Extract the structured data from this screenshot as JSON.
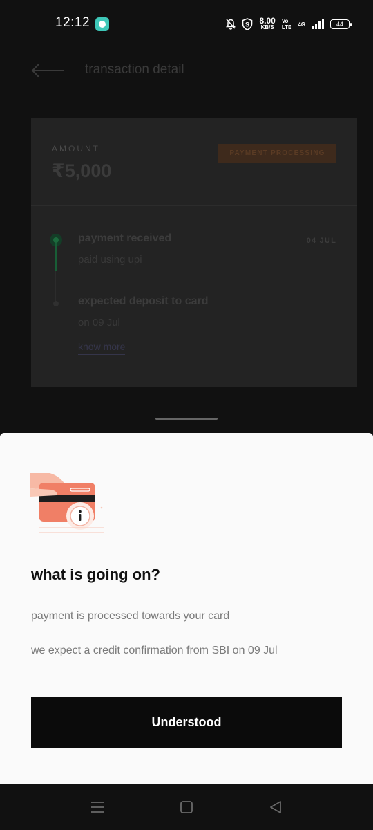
{
  "status_bar": {
    "time": "12:12",
    "net_speed_value": "8.00",
    "net_speed_unit": "KB/S",
    "volte_top": "Vo",
    "volte_bottom": "LTE",
    "network": "4G",
    "battery": "44",
    "icons": [
      "app-notification-icon",
      "bell-muted-icon",
      "shield-s-icon",
      "signal-icon",
      "battery-icon"
    ]
  },
  "header": {
    "back_icon": "arrow-left-icon",
    "title": "transaction detail"
  },
  "transaction": {
    "amount_label": "AMOUNT",
    "amount": "₹5,000",
    "status": "PAYMENT PROCESSING",
    "steps": [
      {
        "title": "payment received",
        "subtitle": "paid using upi",
        "date": "04 JUL"
      },
      {
        "title": "expected deposit to card",
        "subtitle": "on 09 Jul",
        "date": ""
      }
    ],
    "know_more": "know more"
  },
  "sheet": {
    "illustration": "card-info-icon",
    "title": "what is going on?",
    "line1": "payment is processed towards your card",
    "line2": "we expect a credit confirmation from SBI on 09 Jul",
    "button": "Understood"
  },
  "nav": {
    "icons": [
      "menu-icon",
      "home-square-icon",
      "back-triangle-icon"
    ]
  },
  "colors": {
    "background": "#111111",
    "sheet": "#fafafa",
    "button": "#0b0b0b",
    "accent_green": "#1c6a3d",
    "badge_orange": "#3e2a1c"
  }
}
